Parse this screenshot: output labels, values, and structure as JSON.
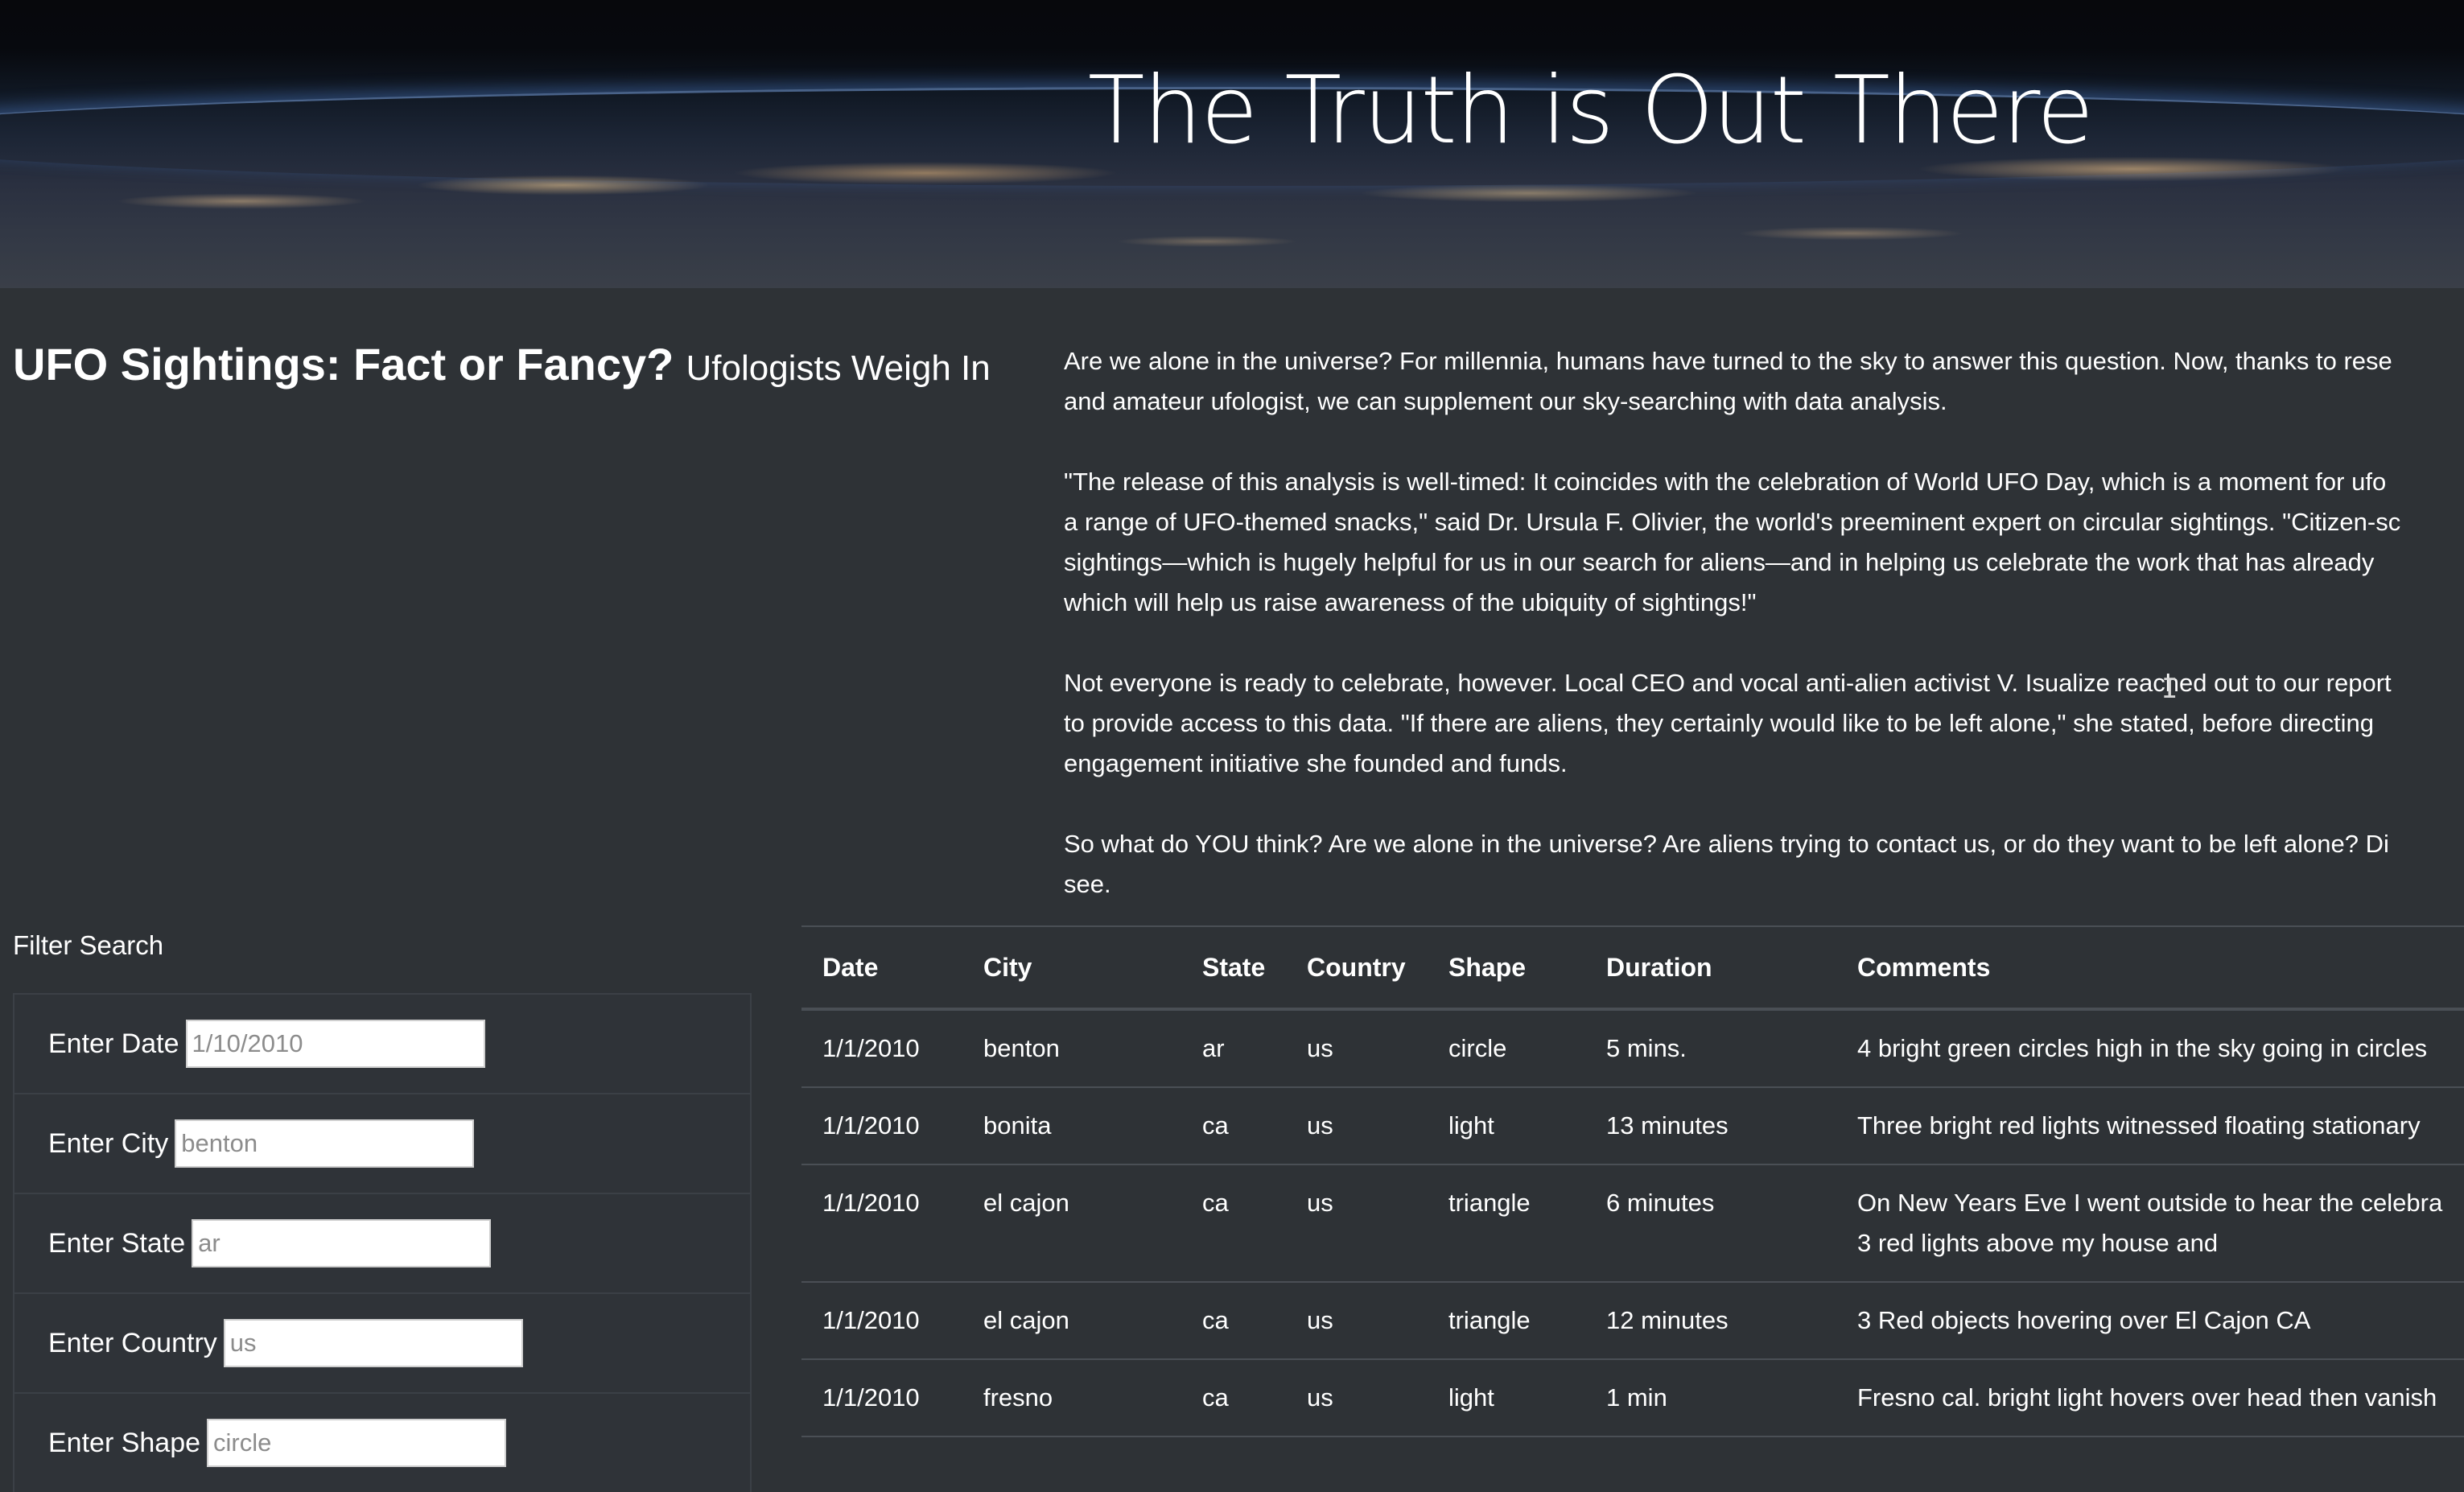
{
  "hero": {
    "title": "The Truth is Out There"
  },
  "headline": {
    "main": "UFO Sightings: Fact or Fancy?",
    "sub": "Ufologists Weigh In"
  },
  "article": {
    "paragraphs": [
      [
        "Are we alone in the universe? For millennia, humans have turned to the sky to answer this question. Now, thanks to rese",
        "and amateur ufologist, we can supplement our sky-searching with data analysis."
      ],
      [
        "\"The release of this analysis is well-timed: It coincides with the celebration of World UFO Day, which is a moment for ufo",
        "a range of UFO-themed snacks,\" said Dr. Ursula F. Olivier, the world's preeminent expert on circular sightings. \"Citizen-sc",
        "sightings—which is hugely helpful for us in our search for aliens—and in helping us celebrate the work that has already",
        "which will help us raise awareness of the ubiquity of sightings!\""
      ],
      [
        "Not everyone is ready to celebrate, however. Local CEO and vocal anti-alien activist V. Isualize reached out to our report",
        "to provide access to this data. \"If there are aliens, they certainly would like to be left alone,\" she stated, before directing",
        "engagement initiative she founded and funds."
      ],
      [
        "So what do YOU think? Are we alone in the universe? Are aliens trying to contact us, or do they want to be left alone? Di",
        "see."
      ]
    ]
  },
  "filter": {
    "title": "Filter Search",
    "fields": [
      {
        "label": "Enter Date",
        "placeholder": "1/10/2010"
      },
      {
        "label": "Enter City",
        "placeholder": "benton"
      },
      {
        "label": "Enter State",
        "placeholder": "ar"
      },
      {
        "label": "Enter Country",
        "placeholder": "us"
      },
      {
        "label": "Enter Shape",
        "placeholder": "circle"
      }
    ]
  },
  "table": {
    "headers": [
      "Date",
      "City",
      "State",
      "Country",
      "Shape",
      "Duration",
      "Comments"
    ],
    "rows": [
      [
        "1/1/2010",
        "benton",
        "ar",
        "us",
        "circle",
        "5 mins.",
        "4 bright green circles high in the sky going in circles"
      ],
      [
        "1/1/2010",
        "bonita",
        "ca",
        "us",
        "light",
        "13 minutes",
        "Three bright red lights witnessed floating stationary"
      ],
      [
        "1/1/2010",
        "el cajon",
        "ca",
        "us",
        "triangle",
        "6 minutes",
        "On New Years Eve I went outside to hear the celebra| 3 red lights above my house and"
      ],
      [
        "1/1/2010",
        "el cajon",
        "ca",
        "us",
        "triangle",
        "12 minutes",
        "3 Red objects hovering over El Cajon CA"
      ],
      [
        "1/1/2010",
        "fresno",
        "ca",
        "us",
        "light",
        "1 min",
        "Fresno cal. bright light hovers over head then vanish"
      ]
    ]
  },
  "icons": {
    "cursor": "text-cursor-icon"
  }
}
